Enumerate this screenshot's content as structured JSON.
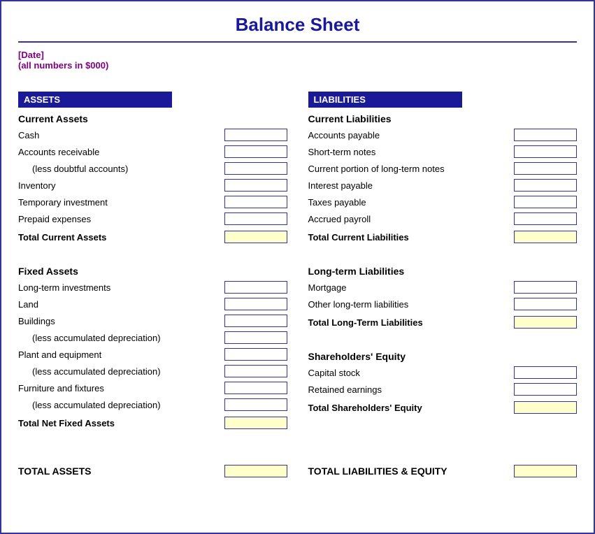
{
  "title": "Balance Sheet",
  "date": "[Date]",
  "numbers_note": "(all numbers in $000)",
  "assets": {
    "header": "ASSETS",
    "current": {
      "title": "Current Assets",
      "items": [
        {
          "label": "Cash",
          "indent": false
        },
        {
          "label": "Accounts receivable",
          "indent": false
        },
        {
          "label": "(less doubtful accounts)",
          "indent": true
        },
        {
          "label": "Inventory",
          "indent": false
        },
        {
          "label": "Temporary investment",
          "indent": false
        },
        {
          "label": "Prepaid expenses",
          "indent": false
        }
      ],
      "total_label": "Total Current Assets"
    },
    "fixed": {
      "title": "Fixed Assets",
      "items": [
        {
          "label": "Long-term investments",
          "indent": false
        },
        {
          "label": "Land",
          "indent": false
        },
        {
          "label": "Buildings",
          "indent": false
        },
        {
          "label": "(less accumulated depreciation)",
          "indent": true
        },
        {
          "label": "Plant and equipment",
          "indent": false
        },
        {
          "label": "(less accumulated depreciation)",
          "indent": true
        },
        {
          "label": "Furniture and fixtures",
          "indent": false
        },
        {
          "label": "(less accumulated depreciation)",
          "indent": true
        }
      ],
      "total_label": "Total Net Fixed Assets"
    },
    "total_label": "TOTAL ASSETS"
  },
  "liabilities": {
    "header": "LIABILITIES",
    "current": {
      "title": "Current Liabilities",
      "items": [
        {
          "label": "Accounts payable",
          "indent": false
        },
        {
          "label": "Short-term notes",
          "indent": false
        },
        {
          "label": "Current portion of long-term notes",
          "indent": false
        },
        {
          "label": "Interest payable",
          "indent": false
        },
        {
          "label": "Taxes payable",
          "indent": false
        },
        {
          "label": "Accrued payroll",
          "indent": false
        }
      ],
      "total_label": "Total Current Liabilities"
    },
    "longterm": {
      "title": "Long-term Liabilities",
      "items": [
        {
          "label": "Mortgage",
          "indent": false
        },
        {
          "label": "Other long-term liabilities",
          "indent": false
        }
      ],
      "total_label": "Total Long-Term Liabilities"
    },
    "equity": {
      "title": "Shareholders' Equity",
      "items": [
        {
          "label": "Capital stock",
          "indent": false
        },
        {
          "label": "Retained earnings",
          "indent": false
        }
      ],
      "total_label": "Total Shareholders' Equity"
    },
    "total_label": "TOTAL LIABILITIES & EQUITY"
  }
}
